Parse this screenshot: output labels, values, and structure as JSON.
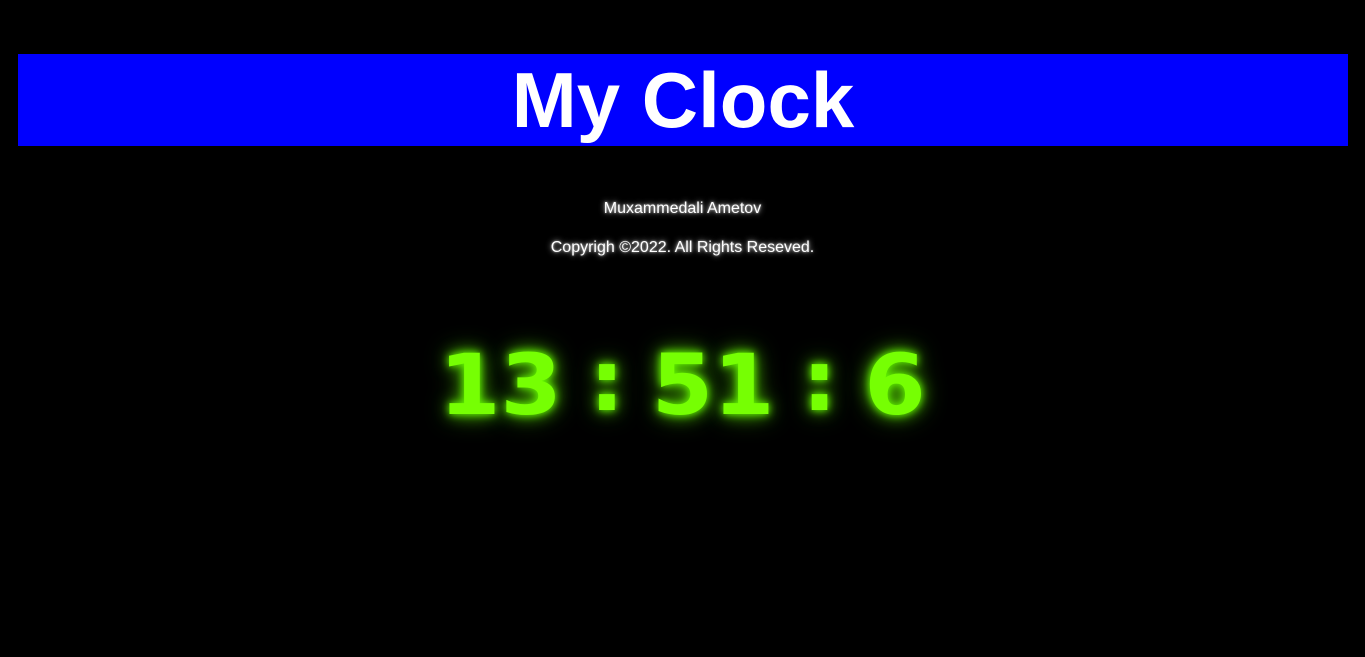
{
  "header": {
    "title": "My Clock",
    "background_color": "#0000ff"
  },
  "author": "Muxammedali Ametov",
  "copyright": "Copyrigh ©2022. All Rights Reseved.",
  "clock": {
    "hours": "13",
    "separator": ":",
    "minutes": "51",
    "seconds": "6",
    "color": "#76ff03"
  },
  "page": {
    "background_color": "#000000"
  }
}
